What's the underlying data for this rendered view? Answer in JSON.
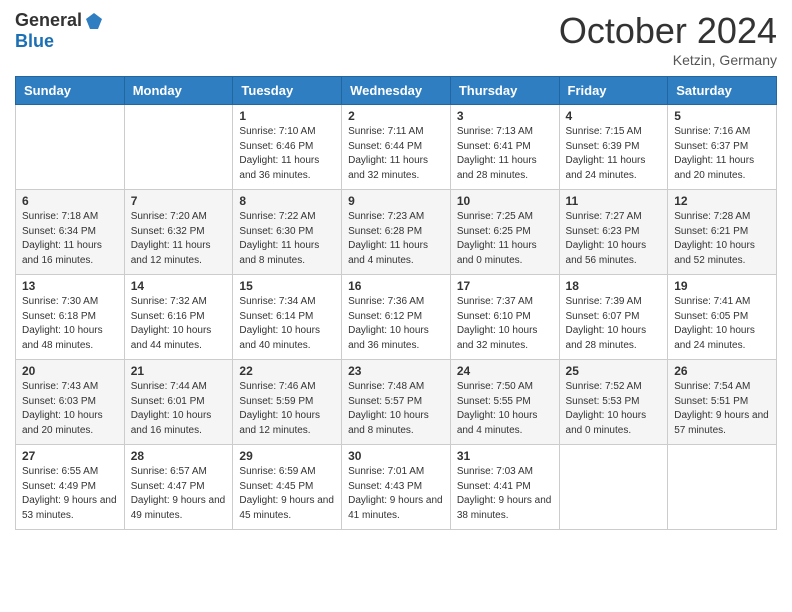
{
  "logo": {
    "general": "General",
    "blue": "Blue"
  },
  "title": "October 2024",
  "subtitle": "Ketzin, Germany",
  "days_of_week": [
    "Sunday",
    "Monday",
    "Tuesday",
    "Wednesday",
    "Thursday",
    "Friday",
    "Saturday"
  ],
  "weeks": [
    [
      {
        "day": "",
        "info": ""
      },
      {
        "day": "",
        "info": ""
      },
      {
        "day": "1",
        "info": "Sunrise: 7:10 AM\nSunset: 6:46 PM\nDaylight: 11 hours and 36 minutes."
      },
      {
        "day": "2",
        "info": "Sunrise: 7:11 AM\nSunset: 6:44 PM\nDaylight: 11 hours and 32 minutes."
      },
      {
        "day": "3",
        "info": "Sunrise: 7:13 AM\nSunset: 6:41 PM\nDaylight: 11 hours and 28 minutes."
      },
      {
        "day": "4",
        "info": "Sunrise: 7:15 AM\nSunset: 6:39 PM\nDaylight: 11 hours and 24 minutes."
      },
      {
        "day": "5",
        "info": "Sunrise: 7:16 AM\nSunset: 6:37 PM\nDaylight: 11 hours and 20 minutes."
      }
    ],
    [
      {
        "day": "6",
        "info": "Sunrise: 7:18 AM\nSunset: 6:34 PM\nDaylight: 11 hours and 16 minutes."
      },
      {
        "day": "7",
        "info": "Sunrise: 7:20 AM\nSunset: 6:32 PM\nDaylight: 11 hours and 12 minutes."
      },
      {
        "day": "8",
        "info": "Sunrise: 7:22 AM\nSunset: 6:30 PM\nDaylight: 11 hours and 8 minutes."
      },
      {
        "day": "9",
        "info": "Sunrise: 7:23 AM\nSunset: 6:28 PM\nDaylight: 11 hours and 4 minutes."
      },
      {
        "day": "10",
        "info": "Sunrise: 7:25 AM\nSunset: 6:25 PM\nDaylight: 11 hours and 0 minutes."
      },
      {
        "day": "11",
        "info": "Sunrise: 7:27 AM\nSunset: 6:23 PM\nDaylight: 10 hours and 56 minutes."
      },
      {
        "day": "12",
        "info": "Sunrise: 7:28 AM\nSunset: 6:21 PM\nDaylight: 10 hours and 52 minutes."
      }
    ],
    [
      {
        "day": "13",
        "info": "Sunrise: 7:30 AM\nSunset: 6:18 PM\nDaylight: 10 hours and 48 minutes."
      },
      {
        "day": "14",
        "info": "Sunrise: 7:32 AM\nSunset: 6:16 PM\nDaylight: 10 hours and 44 minutes."
      },
      {
        "day": "15",
        "info": "Sunrise: 7:34 AM\nSunset: 6:14 PM\nDaylight: 10 hours and 40 minutes."
      },
      {
        "day": "16",
        "info": "Sunrise: 7:36 AM\nSunset: 6:12 PM\nDaylight: 10 hours and 36 minutes."
      },
      {
        "day": "17",
        "info": "Sunrise: 7:37 AM\nSunset: 6:10 PM\nDaylight: 10 hours and 32 minutes."
      },
      {
        "day": "18",
        "info": "Sunrise: 7:39 AM\nSunset: 6:07 PM\nDaylight: 10 hours and 28 minutes."
      },
      {
        "day": "19",
        "info": "Sunrise: 7:41 AM\nSunset: 6:05 PM\nDaylight: 10 hours and 24 minutes."
      }
    ],
    [
      {
        "day": "20",
        "info": "Sunrise: 7:43 AM\nSunset: 6:03 PM\nDaylight: 10 hours and 20 minutes."
      },
      {
        "day": "21",
        "info": "Sunrise: 7:44 AM\nSunset: 6:01 PM\nDaylight: 10 hours and 16 minutes."
      },
      {
        "day": "22",
        "info": "Sunrise: 7:46 AM\nSunset: 5:59 PM\nDaylight: 10 hours and 12 minutes."
      },
      {
        "day": "23",
        "info": "Sunrise: 7:48 AM\nSunset: 5:57 PM\nDaylight: 10 hours and 8 minutes."
      },
      {
        "day": "24",
        "info": "Sunrise: 7:50 AM\nSunset: 5:55 PM\nDaylight: 10 hours and 4 minutes."
      },
      {
        "day": "25",
        "info": "Sunrise: 7:52 AM\nSunset: 5:53 PM\nDaylight: 10 hours and 0 minutes."
      },
      {
        "day": "26",
        "info": "Sunrise: 7:54 AM\nSunset: 5:51 PM\nDaylight: 9 hours and 57 minutes."
      }
    ],
    [
      {
        "day": "27",
        "info": "Sunrise: 6:55 AM\nSunset: 4:49 PM\nDaylight: 9 hours and 53 minutes."
      },
      {
        "day": "28",
        "info": "Sunrise: 6:57 AM\nSunset: 4:47 PM\nDaylight: 9 hours and 49 minutes."
      },
      {
        "day": "29",
        "info": "Sunrise: 6:59 AM\nSunset: 4:45 PM\nDaylight: 9 hours and 45 minutes."
      },
      {
        "day": "30",
        "info": "Sunrise: 7:01 AM\nSunset: 4:43 PM\nDaylight: 9 hours and 41 minutes."
      },
      {
        "day": "31",
        "info": "Sunrise: 7:03 AM\nSunset: 4:41 PM\nDaylight: 9 hours and 38 minutes."
      },
      {
        "day": "",
        "info": ""
      },
      {
        "day": "",
        "info": ""
      }
    ]
  ]
}
